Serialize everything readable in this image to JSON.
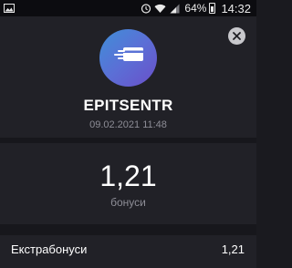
{
  "status_bar": {
    "battery_percent": "64%",
    "time": "14:32",
    "icons": [
      "gallery-icon",
      "alarm-icon",
      "wifi-icon",
      "signal-icon",
      "battery-icon"
    ]
  },
  "transaction": {
    "merchant": "EPITSENTR",
    "datetime": "09.02.2021 11:48",
    "amount": "1,21",
    "amount_label": "бонуси"
  },
  "details": {
    "extra_bonus_label": "Екстрабонуси",
    "extra_bonus_value": "1,21"
  },
  "colors": {
    "background": "#1a1a1f",
    "card": "#212127",
    "muted_text": "#8d8d96",
    "logo_gradient_start": "#3f8fd8",
    "logo_gradient_end": "#6a4fc9"
  },
  "icons": {
    "close": "close-icon",
    "logo": "card-logo-icon"
  }
}
